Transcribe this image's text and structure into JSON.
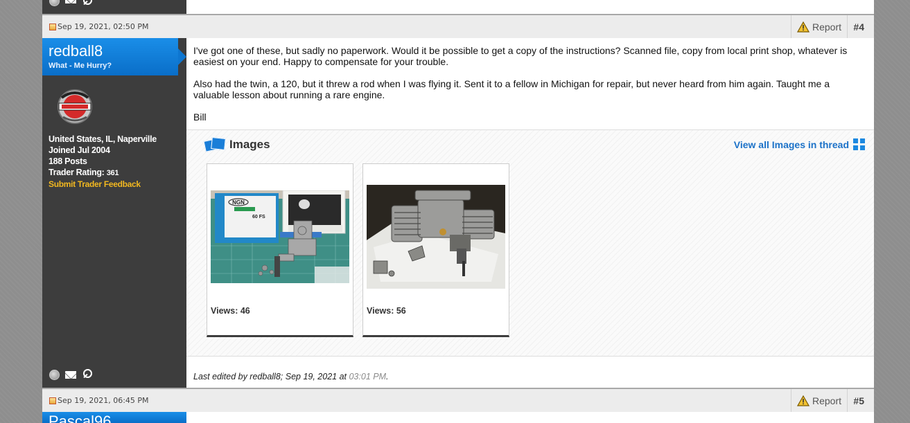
{
  "post4": {
    "date": "Sep 19, 2021, 02:50 PM",
    "report_label": "Report",
    "number": "#4",
    "user": {
      "name": "redball8",
      "title": "What - Me Hurry?",
      "location": "United States, IL, Naperville",
      "joined": "Joined Jul 2004",
      "posts": "188 Posts",
      "trader_label": "Trader Rating:",
      "trader_value": "361",
      "feedback_link": "Submit Trader Feedback"
    },
    "message": [
      "I've got one of these, but sadly no paperwork. Would it be possible to get a copy of the instructions? Scanned file, copy from local print shop, whatever is easiest on your end. Happy to compensate for your trouble.",
      "Also had the twin, a 120, but it threw a rod when I was flying it. Sent it to a fellow in Michigan for repair, but never heard from him again. Taught me a valuable lesson about running a rare engine.",
      "Bill"
    ],
    "images": {
      "title": "Images",
      "view_all": "View all Images in thread",
      "thumbs": [
        {
          "views": "Views: 46",
          "box_label": "NGN",
          "box_text": "60 FS"
        },
        {
          "views": "Views: 56"
        }
      ]
    },
    "edited": {
      "prefix": "Last edited by redball8; Sep 19, 2021 at",
      "time": "03:01 PM",
      "suffix": "."
    }
  },
  "post5": {
    "date": "Sep 19, 2021, 06:45 PM",
    "report_label": "Report",
    "number": "#5",
    "user_name_partial": "Pascal96"
  },
  "colors": {
    "accent_blue": "#0e76d0",
    "sidebar": "#3d3d3d",
    "feedback_gold": "#f2b820",
    "link_blue": "#1c72c8"
  }
}
